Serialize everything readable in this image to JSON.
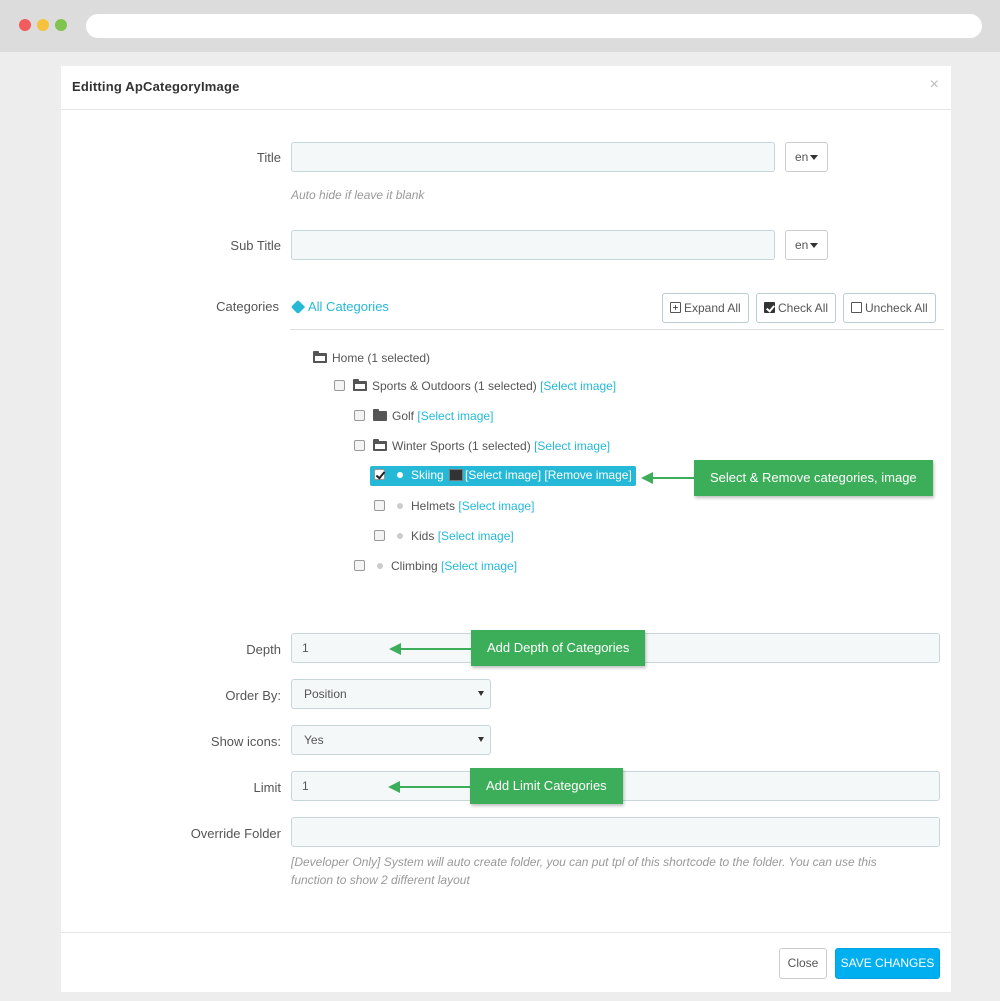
{
  "modal": {
    "title": "Editting ApCategoryImage",
    "close_icon": "×"
  },
  "form": {
    "title_label": "Title",
    "title_value": "",
    "title_lang": "en",
    "title_hint": "Auto hide if leave it blank",
    "subtitle_label": "Sub Title",
    "subtitle_value": "",
    "subtitle_lang": "en",
    "categories_label": "Categories",
    "all_categories": "All Categories",
    "expand_all": "Expand All",
    "check_all": "Check All",
    "uncheck_all": "Uncheck All",
    "depth_label": "Depth",
    "depth_value": "1",
    "orderby_label": "Order By:",
    "orderby_value": "Position",
    "showicons_label": "Show icons:",
    "showicons_value": "Yes",
    "limit_label": "Limit",
    "limit_value": "1",
    "override_label": "Override Folder",
    "override_value": "",
    "override_hint_1": "[Developer Only] System will auto create folder, you can put tpl of this shortcode to the folder. You can use this",
    "override_hint_2": "function to show 2 different layout"
  },
  "tree": {
    "home": "Home (1 selected)",
    "sports": "Sports & Outdoors (1 selected)",
    "golf": "Golf",
    "winter": "Winter Sports (1 selected)",
    "skiing": "Skiing",
    "helmets": "Helmets",
    "kids": "Kids",
    "climbing": "Climbing",
    "select_image": "[Select image]",
    "remove_image": "[Remove image]"
  },
  "callouts": {
    "select_remove": "Select & Remove categories, image",
    "depth": "Add Depth of Categories",
    "limit": "Add Limit Categories"
  },
  "footer": {
    "close": "Close",
    "save": "SAVE CHANGES"
  },
  "colors": {
    "accent": "#25b9d7",
    "save": "#00aff0",
    "callout": "#3cae5a"
  }
}
